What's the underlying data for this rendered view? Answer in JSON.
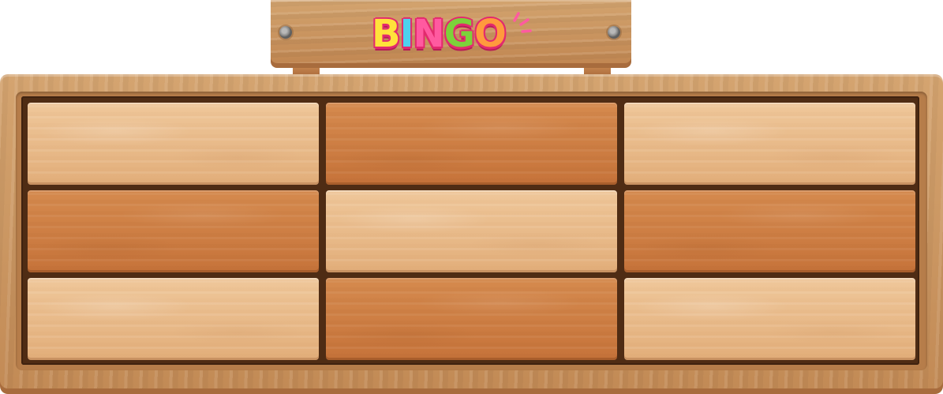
{
  "logo": {
    "text": "BINGO",
    "letters": [
      {
        "char": "B",
        "color": "#ffe23b"
      },
      {
        "char": "I",
        "color": "#4dd1ee"
      },
      {
        "char": "N",
        "color": "#ff5aa0"
      },
      {
        "char": "G",
        "color": "#7cd23a"
      },
      {
        "char": "O",
        "color": "#ff9a3d"
      }
    ],
    "outline_color": "#e22a6e",
    "sparkle_color": "#ff5aa0"
  },
  "sign": {
    "screws": [
      "screw-icon",
      "screw-icon"
    ]
  },
  "board": {
    "rows": 3,
    "columns": 3,
    "tiles": [
      {
        "row": 1,
        "col": 1,
        "tone": "light"
      },
      {
        "row": 1,
        "col": 2,
        "tone": "dark"
      },
      {
        "row": 1,
        "col": 3,
        "tone": "light"
      },
      {
        "row": 2,
        "col": 1,
        "tone": "dark"
      },
      {
        "row": 2,
        "col": 2,
        "tone": "light"
      },
      {
        "row": 2,
        "col": 3,
        "tone": "dark"
      },
      {
        "row": 3,
        "col": 1,
        "tone": "light"
      },
      {
        "row": 3,
        "col": 2,
        "tone": "dark"
      },
      {
        "row": 3,
        "col": 3,
        "tone": "light"
      }
    ]
  }
}
